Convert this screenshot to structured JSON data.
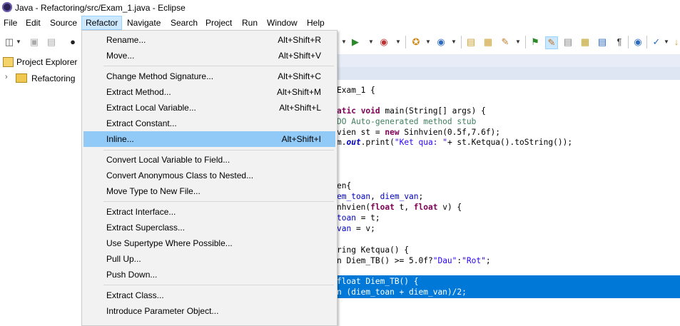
{
  "window": {
    "title": "Java - Refactoring/src/Exam_1.java - Eclipse"
  },
  "menubar": [
    {
      "label": "File"
    },
    {
      "label": "Edit"
    },
    {
      "label": "Source"
    },
    {
      "label": "Refactor"
    },
    {
      "label": "Navigate"
    },
    {
      "label": "Search"
    },
    {
      "label": "Project"
    },
    {
      "label": "Run"
    },
    {
      "label": "Window"
    },
    {
      "label": "Help"
    }
  ],
  "explorer": {
    "title": "Project Explorer",
    "project": "Refactoring"
  },
  "refactor_menu": {
    "items": [
      {
        "label": "Rename...",
        "accel": "Alt+Shift+R"
      },
      {
        "label": "Move...",
        "accel": "Alt+Shift+V"
      },
      {
        "label": "Change Method Signature...",
        "accel": "Alt+Shift+C"
      },
      {
        "label": "Extract Method...",
        "accel": "Alt+Shift+M"
      },
      {
        "label": "Extract Local Variable...",
        "accel": "Alt+Shift+L"
      },
      {
        "label": "Extract Constant...",
        "accel": ""
      },
      {
        "label": "Inline...",
        "accel": "Alt+Shift+I"
      },
      {
        "label": "Convert Local Variable to Field...",
        "accel": ""
      },
      {
        "label": "Convert Anonymous Class to Nested...",
        "accel": ""
      },
      {
        "label": "Move Type to New File...",
        "accel": ""
      },
      {
        "label": "Extract Interface...",
        "accel": ""
      },
      {
        "label": "Extract Superclass...",
        "accel": ""
      },
      {
        "label": "Use Supertype Where Possible...",
        "accel": ""
      },
      {
        "label": "Pull Up...",
        "accel": ""
      },
      {
        "label": "Push Down...",
        "accel": ""
      },
      {
        "label": "Extract Class...",
        "accel": ""
      },
      {
        "label": "Introduce Parameter Object...",
        "accel": ""
      }
    ],
    "highlighted": "Inline..."
  },
  "code": {
    "l1": "Exam_1 {",
    "l2a": "atic ",
    "l2b": "void",
    "l2c": " main(String[] args) {",
    "l3": "DO Auto-generated method stub",
    "l4a": "vien st = ",
    "l4b": "new",
    "l4c": " Sinhvien(0.5f,7.6f);",
    "l5a": "m.",
    "l5b": "out",
    "l5c": ".print(",
    "l5d": "\"Ket qua: \"",
    "l5e": "+ st.Ketqua().toString());",
    "l6": "en{",
    "l7a": "em_toan",
    "l7b": ", ",
    "l7c": "diem_van",
    "l7d": ";",
    "l8a": "nhvien(",
    "l8b": "float",
    "l8c": " t, ",
    "l8d": "float",
    "l8e": " v) {",
    "l9a": "toan",
    "l9b": " = t;",
    "l10a": "van",
    "l10b": " = v;",
    "l11": "ring Ketqua() {",
    "l12a": "n Diem_TB() >= 5.0f?",
    "l12b": "\"Dau\"",
    "l12c": ":",
    "l12d": "\"Rot\"",
    "l12e": ";",
    "l13": "float Diem_TB() {",
    "l14": "n (diem_toan + diem_van)/2;"
  },
  "colors": {
    "menu_highlight": "#91c9f7",
    "selection": "#0078d7",
    "keyword": "#7f0055",
    "string": "#2a00ff",
    "comment": "#3f7f5f"
  }
}
